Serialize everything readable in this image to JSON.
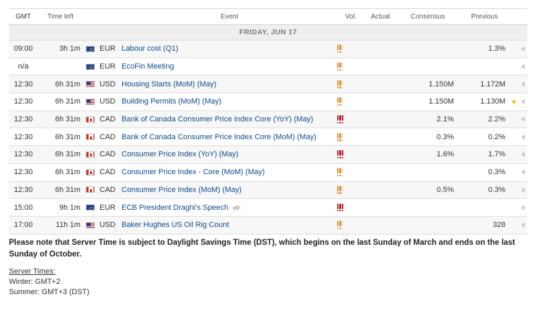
{
  "headers": {
    "gmt": "GMT",
    "time_left": "Time left",
    "event": "Event",
    "vol": "Vol.",
    "actual": "Actual",
    "consensus": "Consensus",
    "previous": "Previous"
  },
  "day_label": "FRIDAY, JUN 17",
  "events": [
    {
      "gmt": "09:00",
      "time_left": "3h 1m",
      "flag": "eu-flag-icon",
      "currency": "EUR",
      "event": "Labour cost (Q1)",
      "volatility": 2,
      "actual": "",
      "consensus": "",
      "previous": "1.3%",
      "speech": false,
      "revised": false
    },
    {
      "gmt": "n/a",
      "time_left": "",
      "flag": "eu-flag-icon",
      "currency": "EUR",
      "event": "EcoFin Meeting",
      "volatility": 2,
      "actual": "",
      "consensus": "",
      "previous": "",
      "speech": false,
      "revised": false
    },
    {
      "gmt": "12:30",
      "time_left": "6h 31m",
      "flag": "us-flag-icon",
      "currency": "USD",
      "event": "Housing Starts (MoM) (May)",
      "volatility": 2,
      "actual": "",
      "consensus": "1.150M",
      "previous": "1.172M",
      "speech": false,
      "revised": false
    },
    {
      "gmt": "12:30",
      "time_left": "6h 31m",
      "flag": "us-flag-icon",
      "currency": "USD",
      "event": "Building Permits (MoM) (May)",
      "volatility": 2,
      "actual": "",
      "consensus": "1.150M",
      "previous": "1.130M",
      "speech": false,
      "revised": true
    },
    {
      "gmt": "12:30",
      "time_left": "6h 31m",
      "flag": "ca-flag-icon",
      "currency": "CAD",
      "event": "Bank of Canada Consumer Price Index Core (YoY) (May)",
      "volatility": 3,
      "actual": "",
      "consensus": "2.1%",
      "previous": "2.2%",
      "speech": false,
      "revised": false
    },
    {
      "gmt": "12:30",
      "time_left": "6h 31m",
      "flag": "ca-flag-icon",
      "currency": "CAD",
      "event": "Bank of Canada Consumer Price Index Core (MoM) (May)",
      "volatility": 2,
      "actual": "",
      "consensus": "0.3%",
      "previous": "0.2%",
      "speech": false,
      "revised": false
    },
    {
      "gmt": "12:30",
      "time_left": "6h 31m",
      "flag": "ca-flag-icon",
      "currency": "CAD",
      "event": "Consumer Price Index (YoY) (May)",
      "volatility": 3,
      "actual": "",
      "consensus": "1.6%",
      "previous": "1.7%",
      "speech": false,
      "revised": false
    },
    {
      "gmt": "12:30",
      "time_left": "6h 31m",
      "flag": "ca-flag-icon",
      "currency": "CAD",
      "event": "Consumer Price Index - Core (MoM) (May)",
      "volatility": 2,
      "actual": "",
      "consensus": "",
      "previous": "0.3%",
      "speech": false,
      "revised": false
    },
    {
      "gmt": "12:30",
      "time_left": "6h 31m",
      "flag": "ca-flag-icon",
      "currency": "CAD",
      "event": "Consumer Price Index (MoM) (May)",
      "volatility": 2,
      "actual": "",
      "consensus": "0.5%",
      "previous": "0.3%",
      "speech": false,
      "revised": false
    },
    {
      "gmt": "15:00",
      "time_left": "9h 1m",
      "flag": "eu-flag-icon",
      "currency": "EUR",
      "event": "ECB President Draghi's Speech",
      "volatility": 3,
      "actual": "",
      "consensus": "",
      "previous": "",
      "speech": true,
      "revised": false
    },
    {
      "gmt": "17:00",
      "time_left": "11h 1m",
      "flag": "us-flag-icon",
      "currency": "USD",
      "event": "Baker Hughes US Oil Rig Count",
      "volatility": 2,
      "actual": "",
      "consensus": "",
      "previous": "328",
      "speech": false,
      "revised": false
    }
  ],
  "note": "Please note that Server Time is subject to Daylight Savings Time (DST), which begins on the last Sunday of March and ends on the last Sunday of October.",
  "server_times": {
    "title": "Server Times:",
    "winter": "Winter: GMT+2",
    "summer": "Summer: GMT+3 (DST)"
  },
  "colors": {
    "volatility_medium": "#e0912b",
    "volatility_high": "#c0181f",
    "event_link": "#0c4a8c",
    "revised_marker": "#f2c200"
  }
}
